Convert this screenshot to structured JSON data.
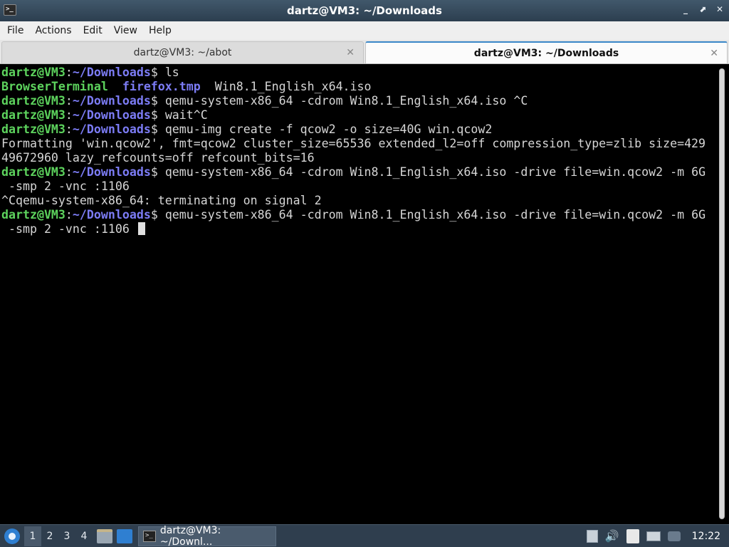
{
  "window": {
    "title": "dartz@VM3: ~/Downloads",
    "buttons": [
      "_",
      "⬈",
      "✕"
    ]
  },
  "menu": [
    "File",
    "Actions",
    "Edit",
    "View",
    "Help"
  ],
  "tabs": [
    {
      "label": "dartz@VM3: ~/abot",
      "active": false
    },
    {
      "label": "dartz@VM3: ~/Downloads",
      "active": true
    }
  ],
  "terminal": {
    "user": "dartz@VM3",
    "cwd": "~/Downloads",
    "lines": [
      {
        "type": "prompt",
        "cmd": "ls"
      },
      {
        "type": "ls",
        "items": [
          "BrowserTerminal",
          "firefox.tmp",
          "Win8.1_English_x64.iso"
        ]
      },
      {
        "type": "prompt",
        "cmd": "qemu-system-x86_64 -cdrom Win8.1_English_x64.iso ^C"
      },
      {
        "type": "prompt",
        "cmd": "wait^C"
      },
      {
        "type": "prompt",
        "cmd": "qemu-img create -f qcow2 -o size=40G win.qcow2"
      },
      {
        "type": "out",
        "text": "Formatting 'win.qcow2', fmt=qcow2 cluster_size=65536 extended_l2=off compression_type=zlib size=429"
      },
      {
        "type": "out",
        "text": "49672960 lazy_refcounts=off refcount_bits=16"
      },
      {
        "type": "prompt",
        "cmd": "qemu-system-x86_64 -cdrom Win8.1_English_x64.iso -drive file=win.qcow2 -m 6G"
      },
      {
        "type": "out",
        "text": " -smp 2 -vnc :1106"
      },
      {
        "type": "out",
        "text": "^Cqemu-system-x86_64: terminating on signal 2"
      },
      {
        "type": "prompt",
        "cmd": "qemu-system-x86_64 -cdrom Win8.1_English_x64.iso -drive file=win.qcow2 -m 6G"
      },
      {
        "type": "out",
        "text": " -smp 2 -vnc :1106 ",
        "cursor": true
      }
    ]
  },
  "taskbar": {
    "workspaces": [
      "1",
      "2",
      "3",
      "4"
    ],
    "active_workspace": "1",
    "task_label": "dartz@VM3: ~/Downl...",
    "clock": "12:22"
  },
  "icons": {
    "start": "start-menu-icon",
    "files": "file-manager-icon",
    "desktop": "show-desktop-icon",
    "terminal": "terminal-icon",
    "tray": [
      "download-icon",
      "volume-icon",
      "clipboard-icon",
      "network-icon",
      "update-icon"
    ]
  }
}
